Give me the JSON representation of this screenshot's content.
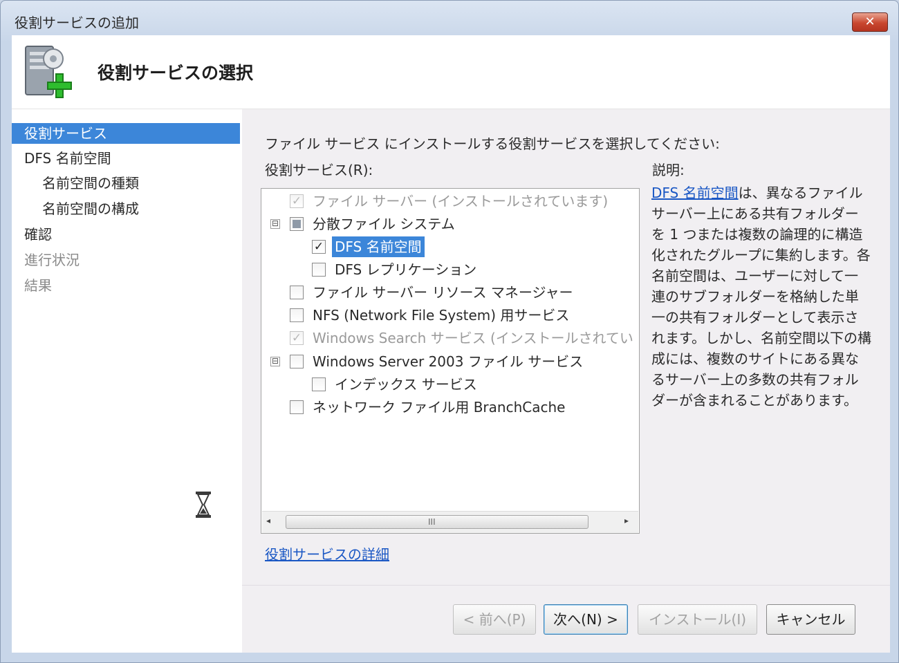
{
  "window": {
    "title": "役割サービスの追加",
    "close_symbol": "✕"
  },
  "header": {
    "title": "役割サービスの選択",
    "icon": "server-add-icon"
  },
  "nav": {
    "items": [
      {
        "label": "役割サービス",
        "state": "active"
      },
      {
        "label": "DFS 名前空間",
        "state": "normal"
      },
      {
        "label": "名前空間の種類",
        "state": "normal"
      },
      {
        "label": "名前空間の構成",
        "state": "normal"
      },
      {
        "label": "確認",
        "state": "normal"
      },
      {
        "label": "進行状況",
        "state": "disabled"
      },
      {
        "label": "結果",
        "state": "disabled"
      }
    ],
    "busy_icon": "hourglass-icon"
  },
  "main": {
    "instruction": "ファイル サービス にインストールする役割サービスを選択してください:",
    "list_label": "役割サービス(R):",
    "description_label": "説明:",
    "services": [
      {
        "label": "ファイル サーバー (インストールされています)",
        "checked": true,
        "disabled": true
      },
      {
        "label": "分散ファイル システム",
        "checked": "partial",
        "expander": "⊟"
      },
      {
        "label": "DFS 名前空間",
        "checked": true,
        "selected": true
      },
      {
        "label": "DFS レプリケーション",
        "checked": false
      },
      {
        "label": "ファイル サーバー リソース マネージャー",
        "checked": false
      },
      {
        "label": "NFS (Network File System) 用サービス",
        "checked": false
      },
      {
        "label": "Windows Search サービス (インストールされてい",
        "checked": true,
        "disabled": true
      },
      {
        "label": "Windows Server 2003 ファイル サービス",
        "checked": false,
        "expander": "⊟"
      },
      {
        "label": "インデックス サービス",
        "checked": false
      },
      {
        "label": "ネットワーク ファイル用 BranchCache",
        "checked": false
      }
    ],
    "description_link": "DFS 名前空間",
    "description_text": "は、異なるファイル サーバー上にある共有フォルダーを 1 つまたは複数の論理的に構造化されたグループに集約します。各名前空間は、ユーザーに対して一連のサブフォルダーを格納した単一の共有フォルダーとして表示されます。しかし、名前空間以下の構成には、複数のサイトにある異なるサーバー上の多数の共有フォルダーが含まれることがあります。",
    "details_link": "役割サービスの詳細",
    "scrollbar": {
      "left": "◂",
      "right": "▸",
      "grip": "III"
    }
  },
  "buttons": {
    "back": "< 前へ(P)",
    "next": "次へ(N) >",
    "install": "インストール(I)",
    "cancel": "キャンセル"
  },
  "colors": {
    "accent": "#3c86d9",
    "link": "#1a57c4",
    "close": "#c9472f"
  }
}
